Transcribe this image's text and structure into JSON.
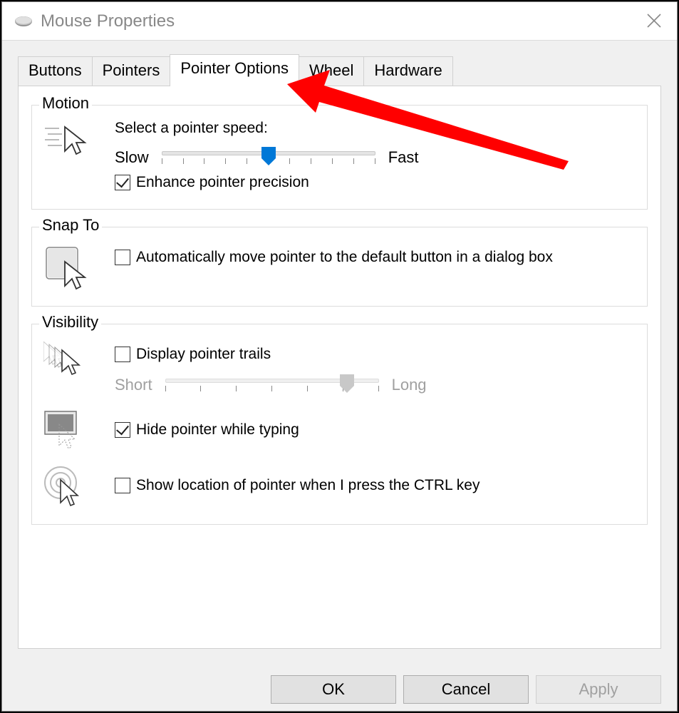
{
  "window": {
    "title": "Mouse Properties"
  },
  "tabs": [
    "Buttons",
    "Pointers",
    "Pointer Options",
    "Wheel",
    "Hardware"
  ],
  "active_tab": "Pointer Options",
  "motion": {
    "title": "Motion",
    "heading": "Select a pointer speed:",
    "slow": "Slow",
    "fast": "Fast",
    "speed_position_pct": 50,
    "enhance_label": "Enhance pointer precision",
    "enhance_checked": true
  },
  "snap": {
    "title": "Snap To",
    "auto_label": "Automatically move pointer to the default button in a dialog box",
    "auto_checked": false
  },
  "visibility": {
    "title": "Visibility",
    "trails_label": "Display pointer trails",
    "trails_checked": false,
    "short": "Short",
    "long": "Long",
    "trail_position_pct": 85,
    "hide_label": "Hide pointer while typing",
    "hide_checked": true,
    "ctrl_label": "Show location of pointer when I press the CTRL key",
    "ctrl_checked": false
  },
  "footer": {
    "ok": "OK",
    "cancel": "Cancel",
    "apply": "Apply"
  },
  "colors": {
    "accent": "#0078d7",
    "arrow": "#ff0000"
  }
}
